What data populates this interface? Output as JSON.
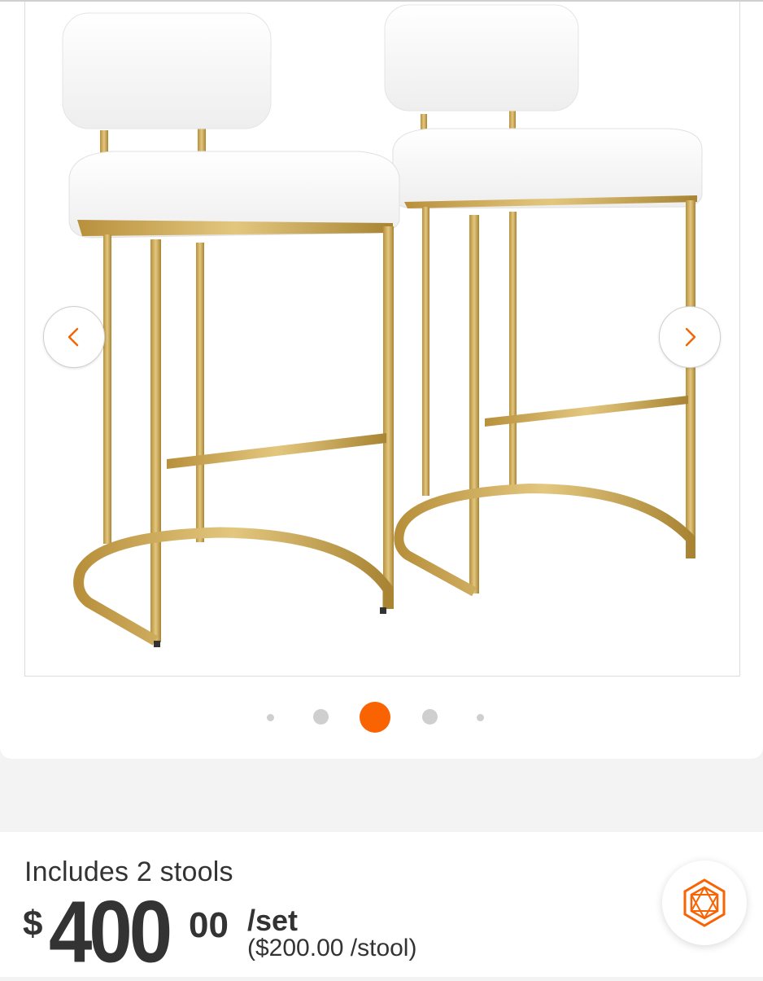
{
  "product": {
    "image_alt": "Two white upholstered bar stools with gold metal frames",
    "carousel": {
      "prev_icon": "chevron-left-icon",
      "next_icon": "chevron-right-icon",
      "dot_count": 5,
      "active_index": 2
    },
    "includes_text": "Includes 2 stools",
    "price": {
      "currency": "$",
      "dollars": "400",
      "cents": "00",
      "unit": "/set",
      "per_item": "($200.00 /stool)"
    }
  },
  "assistant": {
    "icon": "hexagon-assistant-icon"
  },
  "colors": {
    "accent": "#f96302",
    "gold": "#c9a24a",
    "text": "#333333",
    "background": "#f3f3f3"
  }
}
